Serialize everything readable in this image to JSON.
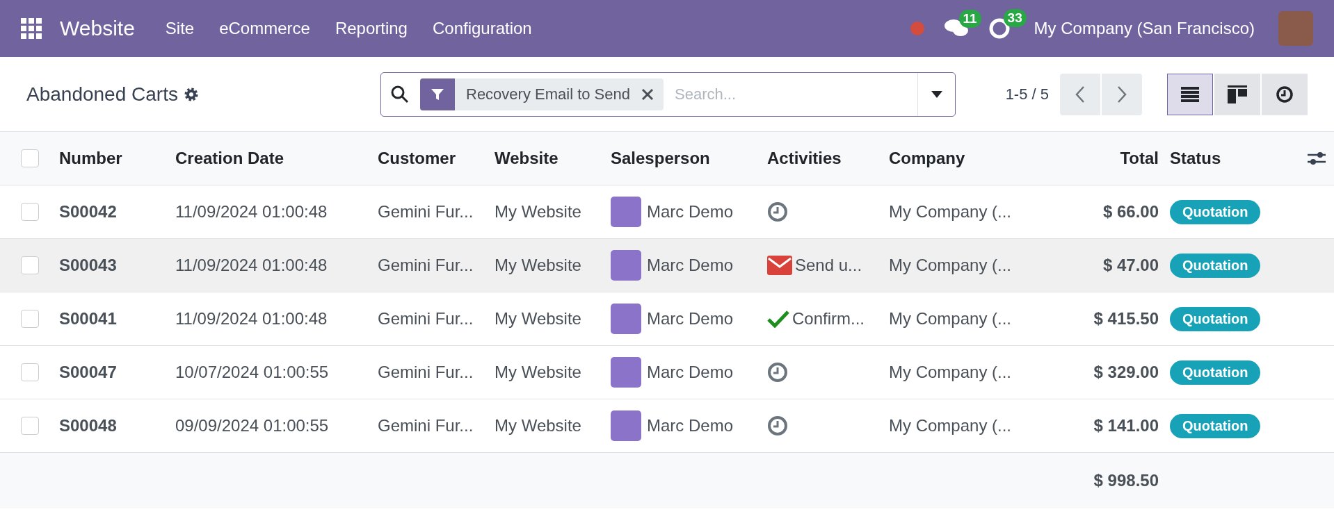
{
  "navbar": {
    "app": "Website",
    "menu": [
      "Site",
      "eCommerce",
      "Reporting",
      "Configuration"
    ],
    "recording": true,
    "messages_count": "11",
    "activities_count": "33",
    "company": "My Company (San Francisco)"
  },
  "control_panel": {
    "title": "Abandoned Carts",
    "filter": "Recovery Email to Send",
    "search": {
      "placeholder": "Search..."
    },
    "pager": "1-5 / 5",
    "views": [
      {
        "kind": "list",
        "selected": true
      },
      {
        "kind": "kanban",
        "selected": false
      },
      {
        "kind": "activity",
        "selected": false
      }
    ]
  },
  "table": {
    "all_checked": false,
    "columns": [
      "Number",
      "Creation Date",
      "Customer",
      "Website",
      "Salesperson",
      "Activities",
      "Company",
      "Total",
      "Status"
    ],
    "rows": [
      {
        "checked": false,
        "hovered": false,
        "number": "S00042",
        "date": "11/09/2024 01:00:48",
        "customer": "Gemini Fur...",
        "website": "My Website",
        "salesperson": "Marc Demo",
        "activity": {
          "kind": "none"
        },
        "company": "My Company (...",
        "total": "$ 66.00",
        "status": "Quotation"
      },
      {
        "checked": false,
        "hovered": true,
        "number": "S00043",
        "date": "11/09/2024 01:00:48",
        "customer": "Gemini Fur...",
        "website": "My Website",
        "salesperson": "Marc Demo",
        "activity": {
          "kind": "email",
          "text": "Send u..."
        },
        "company": "My Company (...",
        "total": "$ 47.00",
        "status": "Quotation"
      },
      {
        "checked": false,
        "hovered": false,
        "number": "S00041",
        "date": "11/09/2024 01:00:48",
        "customer": "Gemini Fur...",
        "website": "My Website",
        "salesperson": "Marc Demo",
        "activity": {
          "kind": "done",
          "text": "Confirm..."
        },
        "company": "My Company (...",
        "total": "$ 415.50",
        "status": "Quotation"
      },
      {
        "checked": false,
        "hovered": false,
        "number": "S00047",
        "date": "10/07/2024 01:00:55",
        "customer": "Gemini Fur...",
        "website": "My Website",
        "salesperson": "Marc Demo",
        "activity": {
          "kind": "none"
        },
        "company": "My Company (...",
        "total": "$ 329.00",
        "status": "Quotation"
      },
      {
        "checked": false,
        "hovered": false,
        "number": "S00048",
        "date": "09/09/2024 01:00:55",
        "customer": "Gemini Fur...",
        "website": "My Website",
        "salesperson": "Marc Demo",
        "activity": {
          "kind": "none"
        },
        "company": "My Company (...",
        "total": "$ 141.00",
        "status": "Quotation"
      }
    ],
    "sum": "$ 998.50"
  }
}
